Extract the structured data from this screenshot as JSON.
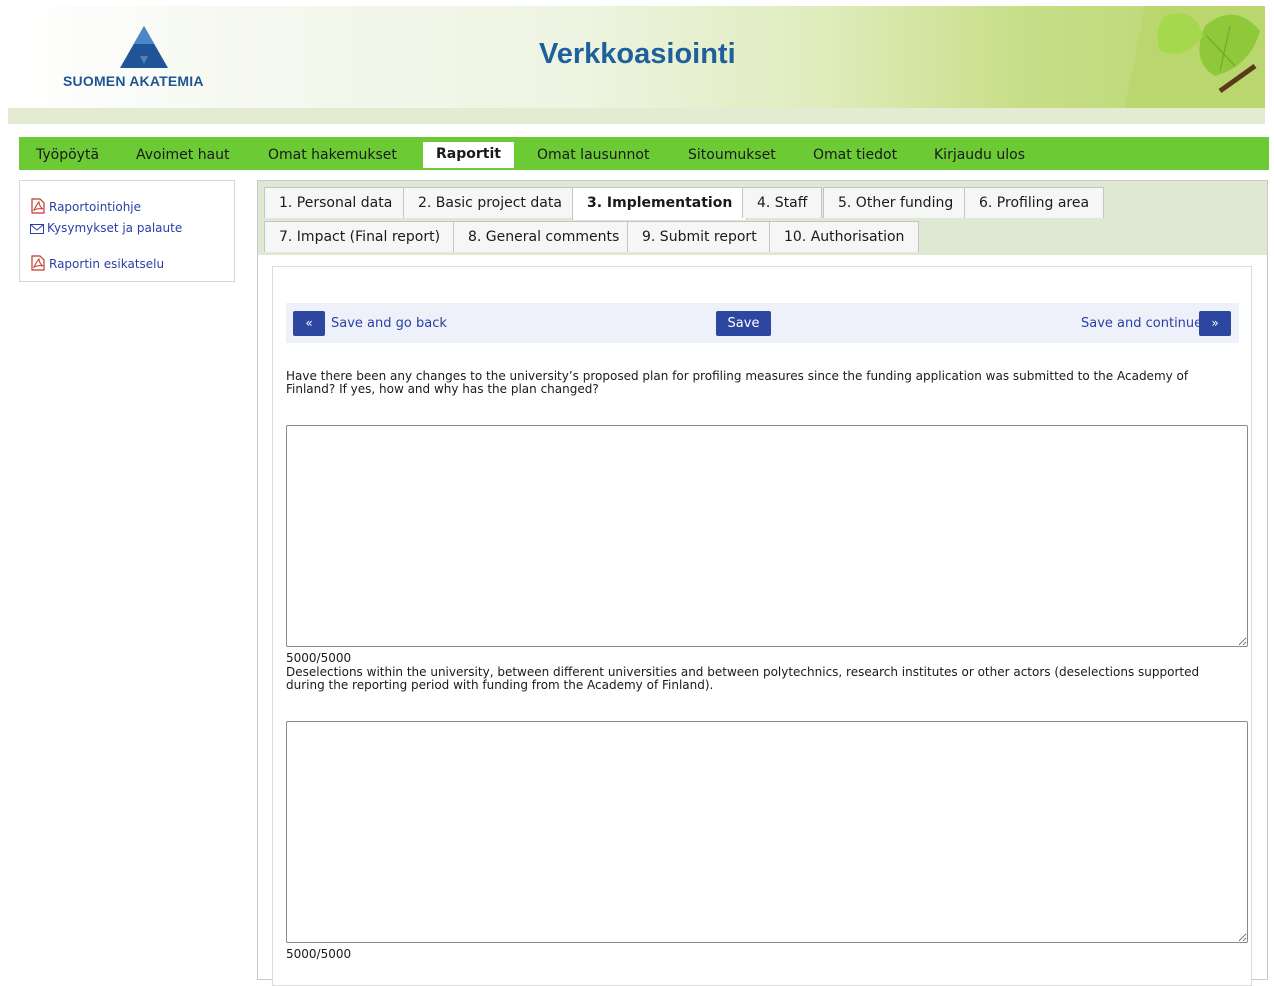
{
  "header": {
    "logo_text": "SUOMEN AKATEMIA",
    "site_title": "Verkkoasiointi"
  },
  "mainnav": {
    "items": [
      {
        "label": "Työpöytä"
      },
      {
        "label": "Avoimet haut"
      },
      {
        "label": "Omat hakemukset"
      },
      {
        "label": "Raportit",
        "active": true
      },
      {
        "label": "Omat lausunnot"
      },
      {
        "label": "Sitoumukset"
      },
      {
        "label": "Omat tiedot"
      },
      {
        "label": "Kirjaudu ulos"
      }
    ]
  },
  "sidebar": {
    "links": [
      {
        "label": "Raportointiohje",
        "icon": "pdf-icon"
      },
      {
        "label": "Kysymykset ja palaute",
        "icon": "envelope-icon"
      },
      {
        "label": "Raportin esikatselu",
        "icon": "pdf-icon"
      }
    ]
  },
  "tabs": [
    {
      "label": "1. Personal data"
    },
    {
      "label": "2. Basic project data"
    },
    {
      "label": "3. Implementation",
      "active": true
    },
    {
      "label": "4. Staff"
    },
    {
      "label": "5. Other funding"
    },
    {
      "label": "6. Profiling area"
    },
    {
      "label": "7. Impact (Final report)"
    },
    {
      "label": "8. General comments"
    },
    {
      "label": "9. Submit report"
    },
    {
      "label": "10. Authorisation"
    }
  ],
  "actions": {
    "back_icon": "«",
    "back_label": "Save and go back",
    "save_label": "Save",
    "continue_label": "Save and continue",
    "continue_icon": "»"
  },
  "questions": [
    {
      "text": "Have there been any changes to the university’s proposed plan for profiling measures since the funding application was submitted to the Academy of Finland? If yes, how and why has the plan changed?",
      "value": "",
      "counter": "5000/5000"
    },
    {
      "text": "Deselections within the university, between different universities and between polytechnics, research institutes or other actors (deselections supported during the reporting period with funding from the Academy of Finland).",
      "value": "",
      "counter": "5000/5000"
    }
  ],
  "colors": {
    "nav_green": "#6ccb35",
    "button_blue": "#2d46a0",
    "link_blue": "#2a3fa5",
    "title_blue": "#1f5f9e"
  }
}
